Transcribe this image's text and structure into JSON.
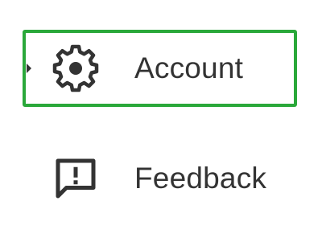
{
  "menu": {
    "items": [
      {
        "label": "Account",
        "icon": "gear-icon",
        "selected": true
      },
      {
        "label": "Feedback",
        "icon": "feedback-icon",
        "selected": false
      }
    ]
  },
  "colors": {
    "focus_border": "#2aa83a",
    "text": "#333333",
    "icon": "#333333"
  }
}
